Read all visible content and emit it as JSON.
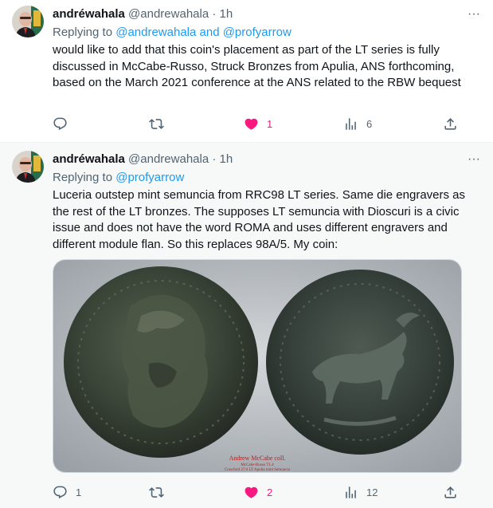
{
  "tweets": [
    {
      "display_name": "andréwahala",
      "handle": "@andrewahala",
      "separator": "·",
      "time": "1h",
      "more": "···",
      "replying_prefix": "Replying to ",
      "replying_to": "@andrewahala and @profyarrow",
      "text": "would like to add that this coin's placement as part of the LT series is fully discussed in McCabe-Russo, Struck Bronzes from Apulia, ANS forthcoming, based on the March 2021 conference at the ANS related to the RBW bequest",
      "actions": {
        "reply": "",
        "retweet": "",
        "like": "1",
        "views": "6"
      },
      "liked": true
    },
    {
      "display_name": "andréwahala",
      "handle": "@andrewahala",
      "separator": "·",
      "time": "1h",
      "more": "···",
      "replying_prefix": "Replying to ",
      "replying_to": "@profyarrow",
      "text": "Luceria outstep mint semuncia from RRC98 LT series. Same die engravers as the rest of the LT bronzes. The supposes LT semuncia with Dioscuri is a civic issue and does not have the word ROMA and uses different engravers and different module flan. So this replaces 98A/5. My coin:",
      "media": {
        "caption_line1": "Andrew McCabe coll.",
        "caption_line2": "McCabe-Russo T1.4",
        "caption_line3": "Crawford 27/4 LT Apulia mint Semuncia"
      },
      "actions": {
        "reply": "1",
        "retweet": "",
        "like": "2",
        "views": "12"
      },
      "liked": true
    }
  ],
  "colors": {
    "link": "#1d9bf0",
    "secondary_text": "#536471",
    "like_pink": "#f91880",
    "background_highlight": "#f7f9f9"
  },
  "icons": [
    "reply-icon",
    "retweet-icon",
    "heart-icon",
    "views-icon",
    "share-icon",
    "more-icon"
  ]
}
